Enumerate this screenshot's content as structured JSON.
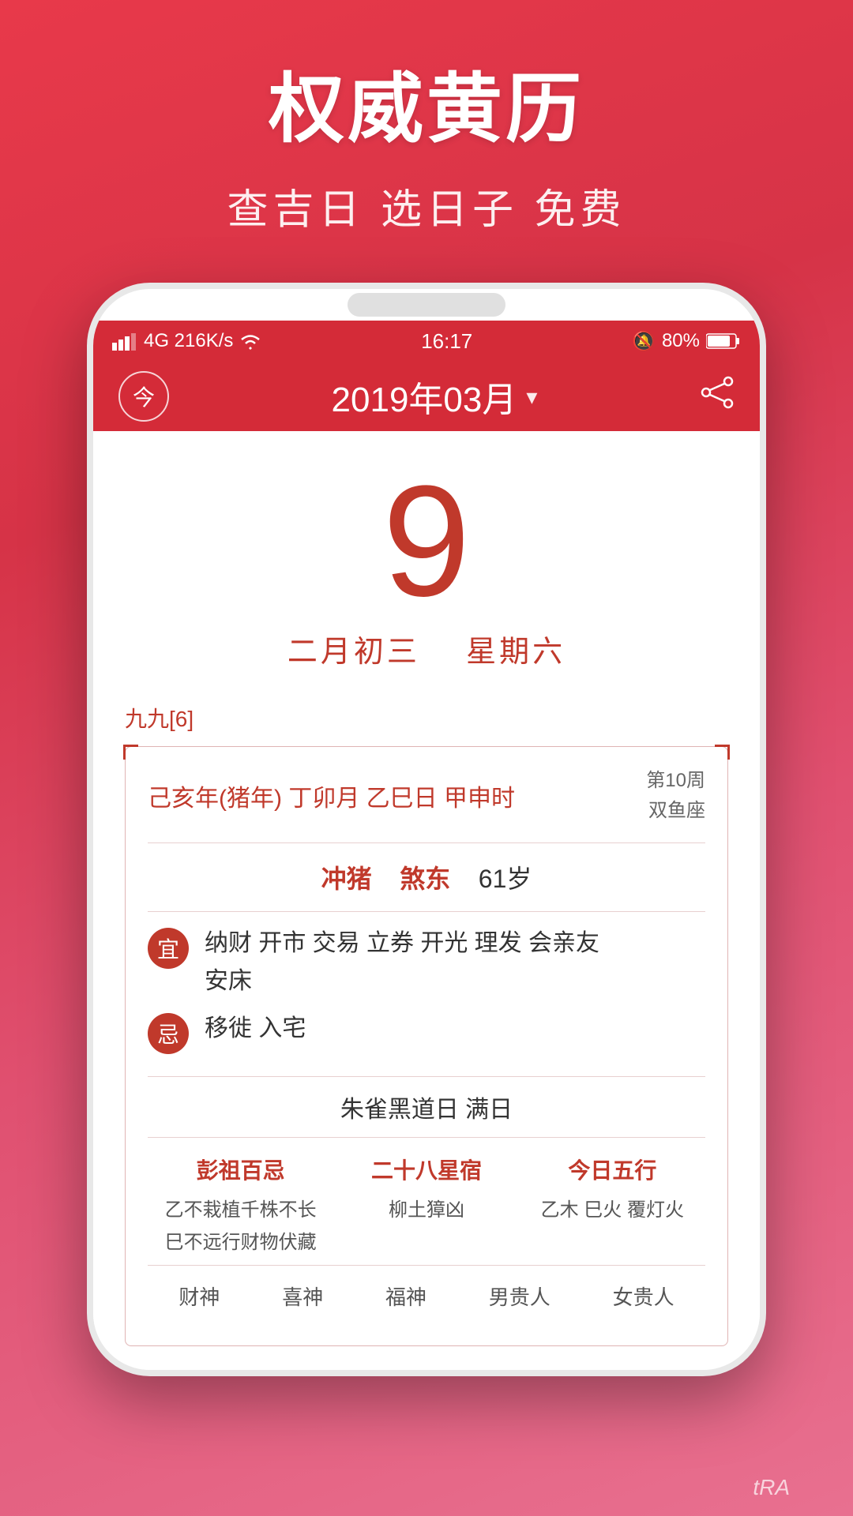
{
  "app": {
    "bg_gradient_start": "#e8394a",
    "bg_gradient_end": "#e87090"
  },
  "marketing": {
    "title": "权威黄历",
    "subtitle": "查吉日 选日子 免费"
  },
  "status_bar": {
    "signal": "4G  216K/s",
    "wifi": "WiFi",
    "time": "16:17",
    "mute": "🔕",
    "battery": "80%"
  },
  "header": {
    "today_label": "今",
    "month_title": "2019年03月",
    "arrow": "▾"
  },
  "date": {
    "day_number": "9",
    "lunar_date": "二月初三",
    "weekday": "星期六"
  },
  "calendar_info": {
    "nine_nine": "九九[6]",
    "ganzhi": "己亥年(猪年) 丁卯月 乙巳日 甲申时",
    "week_num": "第10周",
    "zodiac": "双鱼座",
    "chong": "冲猪",
    "sha": "煞东",
    "age": "61岁",
    "yi_label": "宜",
    "yi_content": "纳财 开市 交易 立券 开光 理发 会亲友\n安床",
    "ji_label": "忌",
    "ji_content": "移徙 入宅",
    "black_day": "朱雀黑道日   满日",
    "pengzu_title": "彭祖百忌",
    "pengzu_content": "乙不栽植千株不长\n巳不远行财物伏藏",
    "xiu_title": "二十八星宿",
    "xiu_content": "柳土獐凶",
    "wuxing_title": "今日五行",
    "wuxing_content": "乙木 巳火 覆灯火",
    "footer_items": [
      "财神",
      "喜神",
      "福神",
      "男贵人",
      "女贵人"
    ]
  },
  "bottom_watermark": "tRA"
}
